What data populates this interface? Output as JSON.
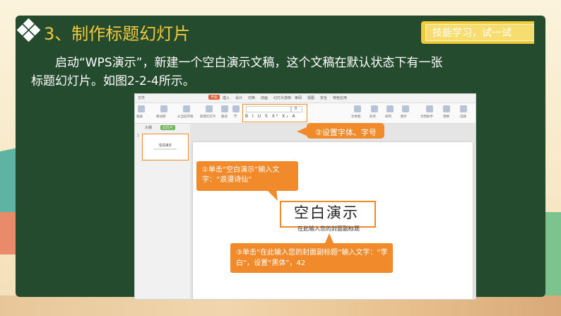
{
  "slide": {
    "title": "3、制作标题幻灯片",
    "skill_tab": "技能学习，试一试",
    "paragraph_line1": "启动“WPS演示”，新建一个空白演示文稿，这个文稿在默认状态下有一张",
    "paragraph_line2": "标题幻灯片。如图2-2-4所示。"
  },
  "wps": {
    "tabs": [
      "文件",
      "开始",
      "插入",
      "设计",
      "切换",
      "动画",
      "幻灯片放映",
      "审阅",
      "视图",
      "安全",
      "特色应用"
    ],
    "active_tab": "开始",
    "ribbon_labels": [
      "粘贴",
      "格式刷",
      "从当前开始",
      "新建幻灯片",
      "版式",
      "节",
      "文本框",
      "形状",
      "排列",
      "图片",
      "文档助手",
      "替换",
      "选择"
    ],
    "font_size_value": "0",
    "panel_tabs": [
      "大纲",
      "幻灯片"
    ],
    "active_panel_tab": "幻灯片",
    "thumb_number": "1",
    "thumb_title": "空白演示",
    "slide_title": "空白演示",
    "slide_subtitle": "在此输入您的封面副标题"
  },
  "callouts": {
    "c1": "①单击“空白演示”输入文字：“浪漫诗仙”",
    "c2": "②设置字体、字号",
    "c3": "③单击“在此输入您的封面副标题”输入文字：“李白”，设置“黑体”，42"
  },
  "colors": {
    "board": "#254b2f",
    "title": "#f2c93b",
    "callout": "#f08a2a",
    "wps_accent": "#e25e33"
  }
}
